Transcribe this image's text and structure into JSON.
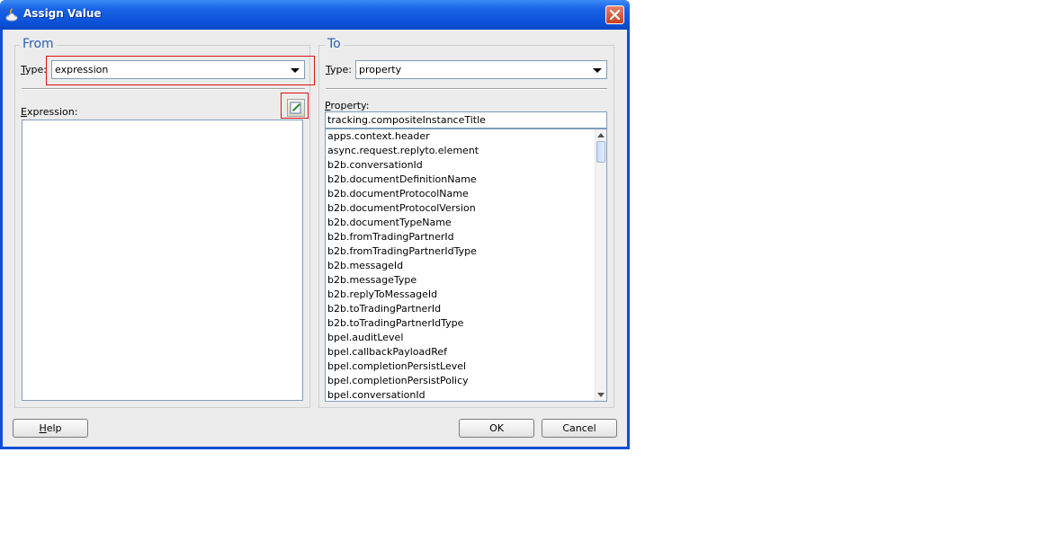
{
  "window": {
    "title": "Assign Value"
  },
  "from": {
    "legend": "From",
    "type_label_accel": "T",
    "type_label_rest": "ype:",
    "type_value": "expression",
    "expression_label_accel": "E",
    "expression_label_rest": "xpression:"
  },
  "to": {
    "legend": "To",
    "type_label_accel": "T",
    "type_label_rest": "ype:",
    "type_value": "property",
    "property_label_accel": "P",
    "property_label_rest": "roperty:",
    "property_value": "tracking.compositeInstanceTitle",
    "property_list": [
      "apps.context.header",
      "async.request.replyto.element",
      "b2b.conversationId",
      "b2b.documentDefinitionName",
      "b2b.documentProtocolName",
      "b2b.documentProtocolVersion",
      "b2b.documentTypeName",
      "b2b.fromTradingPartnerId",
      "b2b.fromTradingPartnerIdType",
      "b2b.messageId",
      "b2b.messageType",
      "b2b.replyToMessageId",
      "b2b.toTradingPartnerId",
      "b2b.toTradingPartnerIdType",
      "bpel.auditLevel",
      "bpel.callbackPayloadRef",
      "bpel.completionPersistLevel",
      "bpel.completionPersistPolicy",
      "bpel.conversationId"
    ]
  },
  "buttons": {
    "help_accel": "H",
    "help_rest": "elp",
    "ok": "OK",
    "cancel": "Cancel"
  },
  "icons": {
    "title": "app-icon",
    "close": "close-icon",
    "expression_builder": "expression-builder-icon"
  },
  "colors": {
    "titlebar": "#0a50d6",
    "legend": "#2a5fb0",
    "highlight_box": "#e01010"
  }
}
